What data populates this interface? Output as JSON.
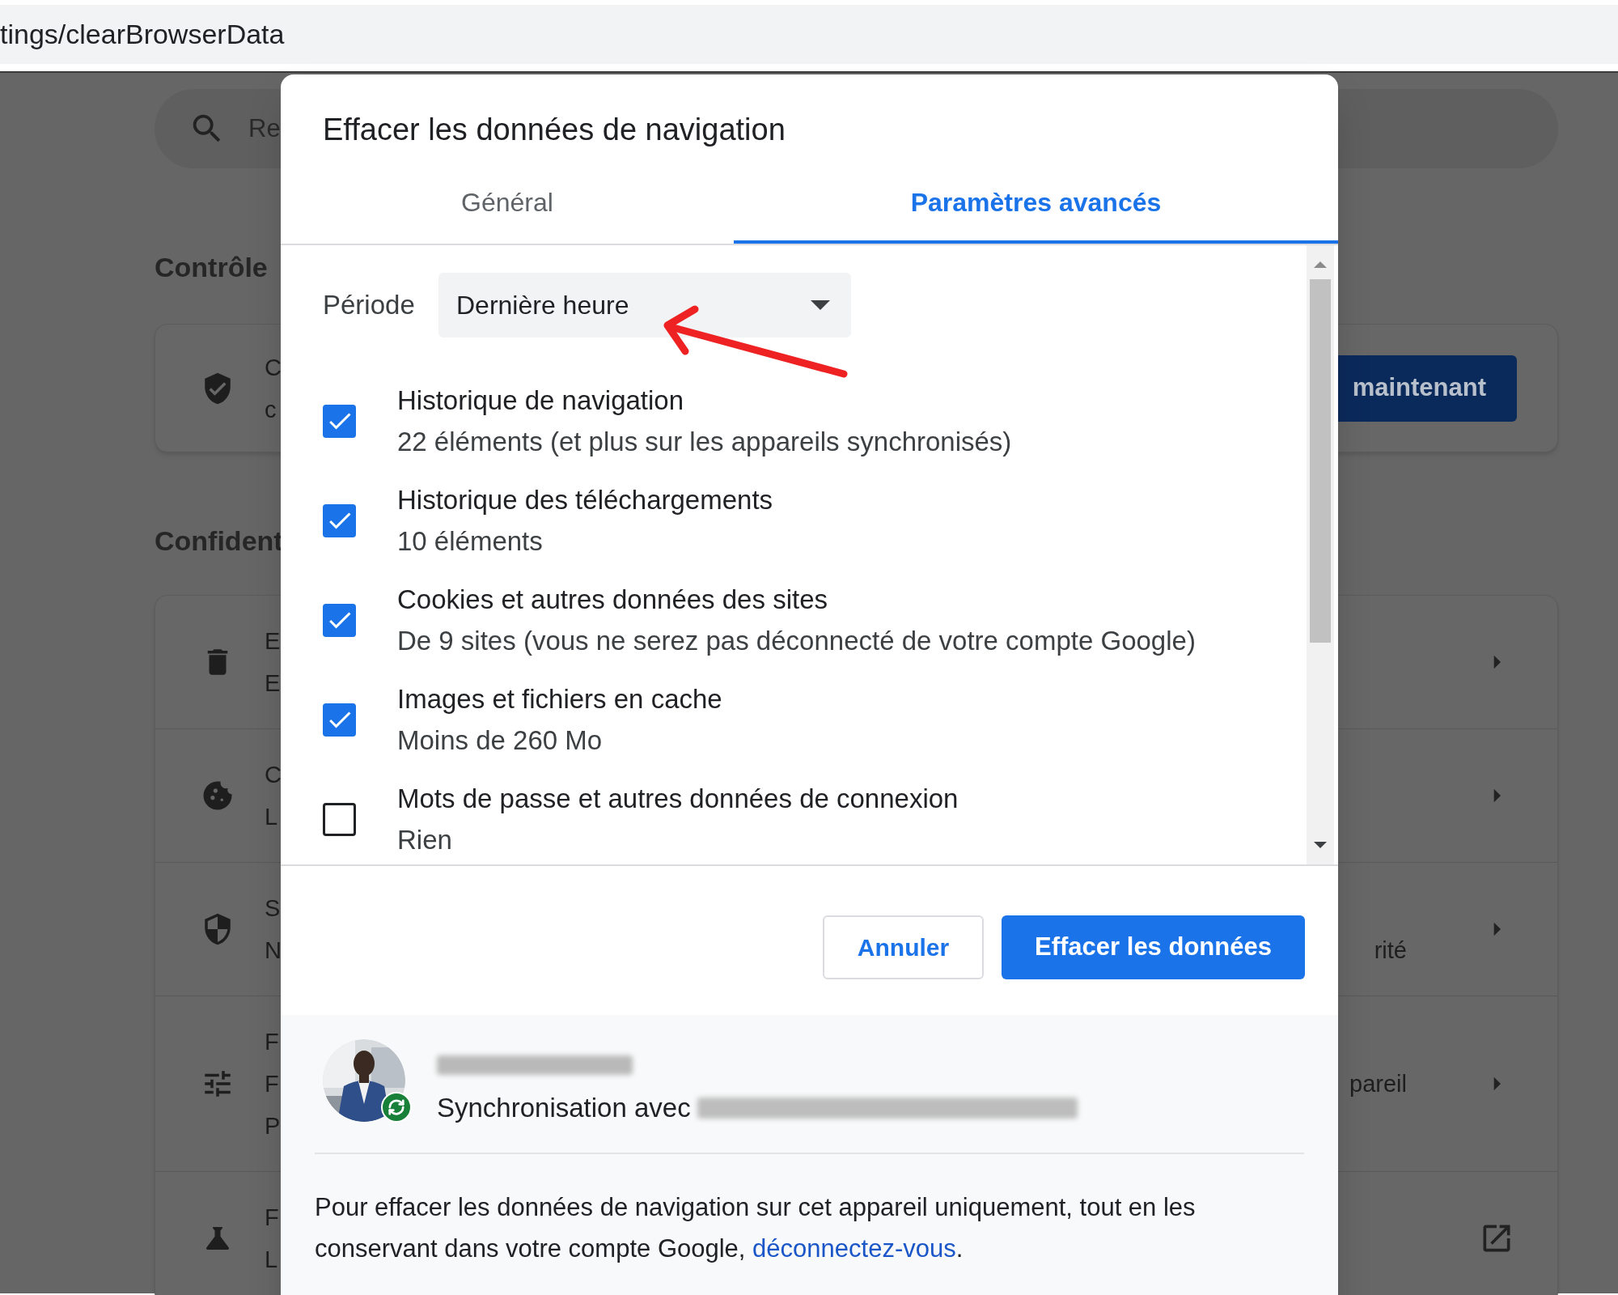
{
  "address_bar": {
    "url": "tings/clearBrowserData"
  },
  "background_page": {
    "search_placeholder": "Re",
    "sections": [
      {
        "title": "Contrôle",
        "rows": [
          {
            "lines": [
              "C",
              "c"
            ],
            "button": "maintenant"
          }
        ]
      },
      {
        "title": "Confident",
        "rows": [
          {
            "lines": [
              "E",
              "E"
            ],
            "kind": "arrow"
          },
          {
            "lines": [
              "C",
              "L"
            ],
            "kind": "arrow"
          },
          {
            "lines": [
              "S",
              "N"
            ],
            "trailing": "rité",
            "kind": "arrow"
          },
          {
            "lines": [
              "F",
              "F",
              "P"
            ],
            "trailing": "pareil",
            "kind": "arrow"
          },
          {
            "lines": [
              "F",
              "L"
            ],
            "kind": "external"
          }
        ]
      }
    ]
  },
  "dialog": {
    "title": "Effacer les données de navigation",
    "tabs": [
      {
        "label": "Général",
        "selected": false
      },
      {
        "label": "Paramètres avancés",
        "selected": true
      }
    ],
    "period": {
      "label": "Période",
      "value": "Dernière heure"
    },
    "items": [
      {
        "title": "Historique de navigation",
        "detail": "22 éléments (et plus sur les appareils synchronisés)",
        "checked": true
      },
      {
        "title": "Historique des téléchargements",
        "detail": "10 éléments",
        "checked": true
      },
      {
        "title": "Cookies et autres données des sites",
        "detail": "De 9 sites (vous ne serez pas déconnecté de votre compte Google)",
        "checked": true
      },
      {
        "title": "Images et fichiers en cache",
        "detail": "Moins de 260 Mo",
        "checked": true
      },
      {
        "title": "Mots de passe et autres données de connexion",
        "detail": "Rien",
        "checked": false
      }
    ],
    "buttons": [
      {
        "label": "Annuler",
        "kind": "secondary"
      },
      {
        "label": "Effacer les données",
        "kind": "primary"
      }
    ],
    "account": {
      "sync_label": "Synchronisation avec"
    },
    "note": {
      "text": "Pour effacer les données de navigation sur cet appareil uniquement, tout en les conservant dans votre compte Google, ",
      "link": "déconnectez-vous",
      "end": "."
    }
  }
}
